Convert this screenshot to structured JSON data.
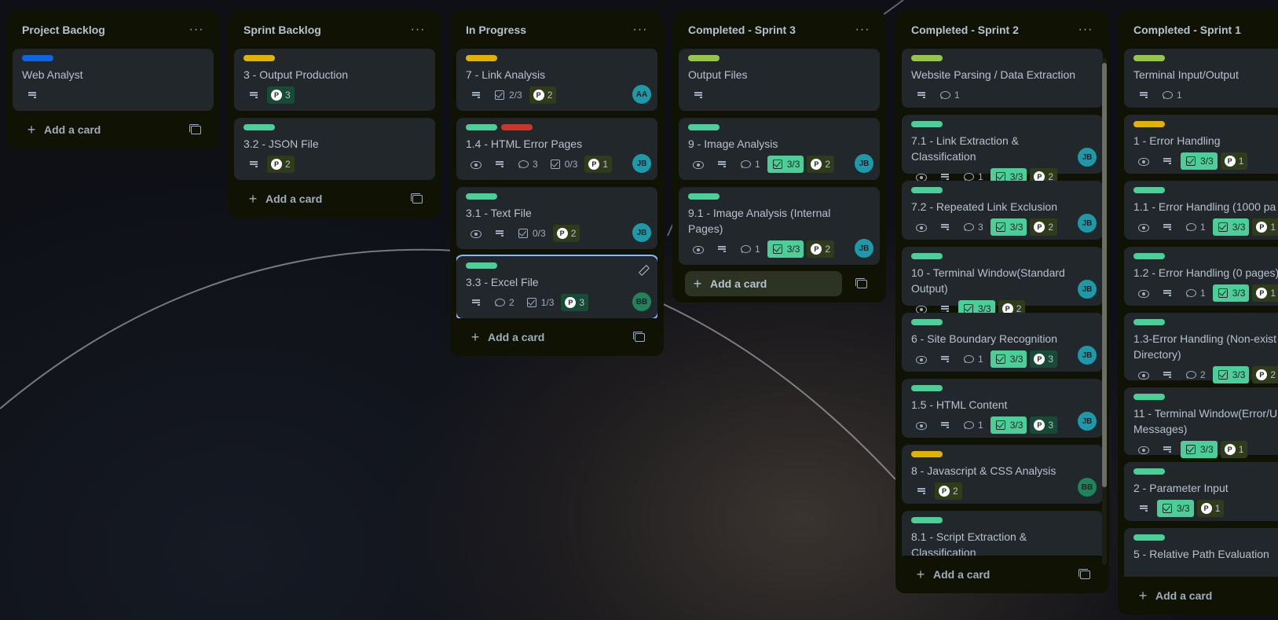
{
  "colors": {
    "blue": "#0c66e4",
    "yellow": "#e2b203",
    "green": "#4bce97",
    "lime": "#94c748",
    "red": "#c9372c",
    "avatar_teal": "#1d9aaa",
    "avatar_green": "#1f845a"
  },
  "board": {
    "add_card_label": "Add a card",
    "lists": [
      {
        "title": "Project Backlog",
        "cards": [
          {
            "labels": [
              "blue"
            ],
            "title": "Web Analyst",
            "desc": true
          }
        ]
      },
      {
        "title": "Sprint Backlog",
        "cards": [
          {
            "labels": [
              "yellow"
            ],
            "title": "3 - Output Production",
            "desc": true,
            "points": "3",
            "points_alt": true
          },
          {
            "labels": [
              "green"
            ],
            "title": "3.2 - JSON File",
            "desc": true,
            "points": "2"
          }
        ]
      },
      {
        "title": "In Progress",
        "cards": [
          {
            "labels": [
              "yellow"
            ],
            "title": "7 - Link Analysis",
            "desc": true,
            "checklist": "2/3",
            "points": "2",
            "avatar": "AA"
          },
          {
            "labels": [
              "green",
              "red"
            ],
            "title": "1.4 - HTML Error Pages",
            "watch": true,
            "desc": true,
            "comments": "3",
            "checklist": "0/3",
            "points": "1",
            "avatar": "JB"
          },
          {
            "labels": [
              "green"
            ],
            "title": "3.1 - Text File",
            "watch": true,
            "desc": true,
            "checklist": "0/3",
            "points": "2",
            "avatar": "JB"
          },
          {
            "labels": [
              "green"
            ],
            "title": "3.3 - Excel File",
            "desc": true,
            "comments": "2",
            "checklist": "1/3",
            "points": "3",
            "points_alt": true,
            "avatar": "BB",
            "selected": true
          }
        ]
      },
      {
        "title": "Completed - Sprint 3",
        "add_hover": true,
        "cards": [
          {
            "labels": [
              "lime"
            ],
            "title": "Output Files",
            "desc": true
          },
          {
            "labels": [
              "green"
            ],
            "title": "9 - Image Analysis",
            "watch": true,
            "desc": true,
            "comments": "1",
            "checklist": "3/3",
            "check_done": true,
            "points": "2",
            "avatar": "JB"
          },
          {
            "labels": [
              "green"
            ],
            "title": "9.1 - Image Analysis (Internal Pages)",
            "watch": true,
            "desc": true,
            "comments": "1",
            "checklist": "3/3",
            "check_done": true,
            "points": "2",
            "avatar": "JB"
          }
        ]
      },
      {
        "title": "Completed - Sprint 2",
        "scroll": true,
        "cards": [
          {
            "labels": [
              "lime"
            ],
            "title": "Website Parsing / Data Extraction",
            "desc": true,
            "comments": "1"
          },
          {
            "labels": [
              "green"
            ],
            "title": "7.1 - Link Extraction & Classification",
            "watch": true,
            "desc": true,
            "comments": "1",
            "checklist": "3/3",
            "check_done": true,
            "points": "2",
            "avatar": "JB"
          },
          {
            "labels": [
              "green"
            ],
            "title": "7.2 - Repeated Link Exclusion",
            "watch": true,
            "desc": true,
            "comments": "3",
            "checklist": "3/3",
            "check_done": true,
            "points": "2",
            "avatar": "JB"
          },
          {
            "labels": [
              "green"
            ],
            "title": "10 - Terminal Window(Standard Output)",
            "watch": true,
            "desc": true,
            "checklist": "3/3",
            "check_done": true,
            "points": "2",
            "avatar": "JB"
          },
          {
            "labels": [
              "green"
            ],
            "title": "6 - Site Boundary Recognition",
            "watch": true,
            "desc": true,
            "comments": "1",
            "checklist": "3/3",
            "check_done": true,
            "points": "3",
            "points_alt": true,
            "avatar": "JB"
          },
          {
            "labels": [
              "green"
            ],
            "title": "1.5 - HTML Content",
            "watch": true,
            "desc": true,
            "comments": "1",
            "checklist": "3/3",
            "check_done": true,
            "points": "3",
            "points_alt": true,
            "avatar": "JB"
          },
          {
            "labels": [
              "yellow"
            ],
            "title": "8 - Javascript & CSS Analysis",
            "desc": true,
            "points": "2",
            "avatar": "BB"
          },
          {
            "labels": [
              "green"
            ],
            "title": "8.1 - Script Extraction & Classification",
            "partial": true
          }
        ]
      },
      {
        "title": "Completed - Sprint 1",
        "cards": [
          {
            "labels": [
              "lime"
            ],
            "title": "Terminal Input/Output",
            "desc": true,
            "comments": "1"
          },
          {
            "labels": [
              "yellow"
            ],
            "title": "1 - Error Handling",
            "watch": true,
            "desc": true,
            "checklist": "3/3",
            "check_done": true,
            "points": "1"
          },
          {
            "labels": [
              "green"
            ],
            "title": "1.1 - Error Handling (1000 pa",
            "watch": true,
            "desc": true,
            "comments": "1",
            "checklist": "3/3",
            "check_done": true,
            "points": "1"
          },
          {
            "labels": [
              "green"
            ],
            "title": "1.2 - Error Handling (0 pages)",
            "watch": true,
            "desc": true,
            "comments": "1",
            "checklist": "3/3",
            "check_done": true,
            "points": "1"
          },
          {
            "labels": [
              "green"
            ],
            "title": "1.3-Error Handling (Non-exist Directory)",
            "watch": true,
            "desc": true,
            "comments": "2",
            "checklist": "3/3",
            "check_done": true,
            "points": "2"
          },
          {
            "labels": [
              "green"
            ],
            "title": "11 - Terminal Window(Error/U Messages)",
            "watch": true,
            "desc": true,
            "checklist": "3/3",
            "check_done": true,
            "points": "1"
          },
          {
            "labels": [
              "green"
            ],
            "title": "2 - Parameter Input",
            "desc": true,
            "checklist": "3/3",
            "check_done": true,
            "points": "1"
          },
          {
            "labels": [
              "green"
            ],
            "title": "5 - Relative Path Evaluation",
            "partial": true
          }
        ]
      }
    ]
  }
}
